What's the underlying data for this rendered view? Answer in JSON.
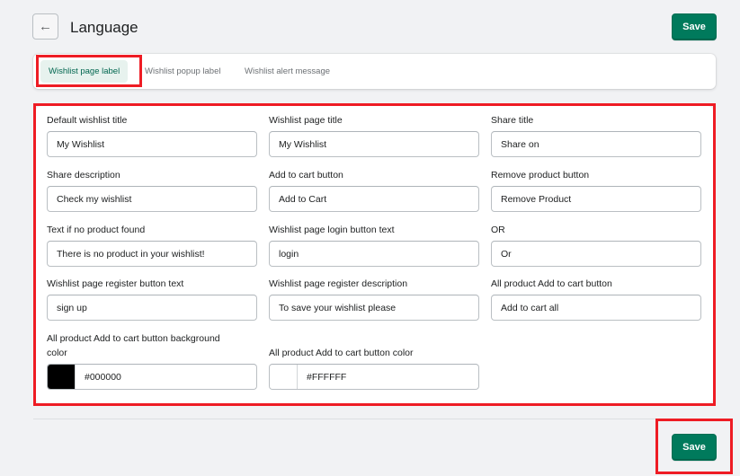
{
  "header": {
    "back_icon": "arrow-left-icon",
    "title": "Language",
    "save_label": "Save"
  },
  "tabs": [
    {
      "label": "Wishlist page label",
      "active": true
    },
    {
      "label": "Wishlist popup label",
      "active": false
    },
    {
      "label": "Wishlist alert message",
      "active": false
    }
  ],
  "fields": {
    "default_wishlist_title": {
      "label": "Default wishlist title",
      "value": "My Wishlist"
    },
    "wishlist_page_title": {
      "label": "Wishlist page title",
      "value": "My Wishlist"
    },
    "share_title": {
      "label": "Share title",
      "value": "Share on"
    },
    "share_description": {
      "label": "Share description",
      "value": "Check my wishlist"
    },
    "add_to_cart_button": {
      "label": "Add to cart button",
      "value": "Add to Cart"
    },
    "remove_product_button": {
      "label": "Remove product button",
      "value": "Remove Product"
    },
    "text_no_product": {
      "label": "Text if no product found",
      "value": "There is no product in your wishlist!"
    },
    "login_button_text": {
      "label": "Wishlist page login button text",
      "value": "login"
    },
    "or_text": {
      "label": "OR",
      "value": "Or"
    },
    "register_button_text": {
      "label": "Wishlist page register button text",
      "value": "sign up"
    },
    "register_description": {
      "label": "Wishlist page register description",
      "value": "To save your wishlist please"
    },
    "all_add_to_cart_button": {
      "label": "All product Add to cart button",
      "value": "Add to cart all"
    },
    "all_add_to_cart_bg_color": {
      "label_line1": "All product Add to cart button background",
      "label_line2": "color",
      "value": "#000000"
    },
    "all_add_to_cart_color": {
      "label": "All product Add to cart button color",
      "value": "#FFFFFF"
    }
  },
  "footer": {
    "save_label": "Save"
  },
  "colors": {
    "primary": "#007a5c",
    "tab_active_bg": "#e7f2ee",
    "highlight": "#ee1c24",
    "swatch_black": "#000000",
    "swatch_white": "#ffffff"
  }
}
